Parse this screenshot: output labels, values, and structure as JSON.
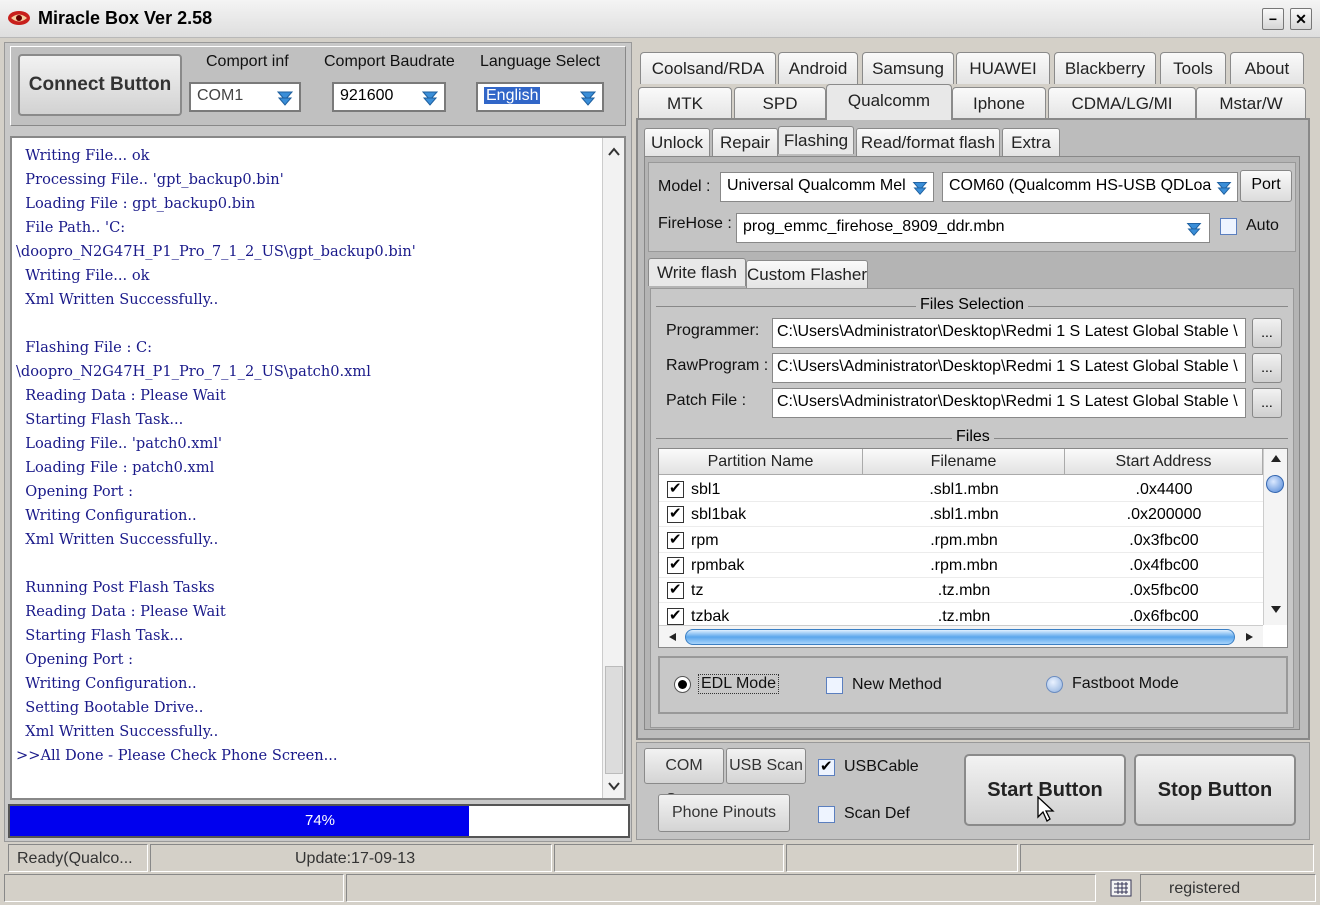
{
  "window": {
    "title": "Miracle Box Ver 2.58",
    "minimize": "−",
    "close": "✕"
  },
  "top": {
    "connect_label": "Connect Button",
    "comport_label": "Comport inf",
    "comport_value": "COM1",
    "baud_label": "Comport Baudrate",
    "baud_value": "921600",
    "lang_label": "Language Select",
    "lang_value": "English"
  },
  "log": {
    "lines": [
      "  Writing File... ok",
      "  Processing File.. 'gpt_backup0.bin'",
      "  Loading File : gpt_backup0.bin",
      "  File Path.. 'C:",
      "\\doopro_N2G47H_P1_Pro_7_1_2_US\\gpt_backup0.bin'",
      "  Writing File... ok",
      "  Xml Written Successfully..",
      "",
      "  Flashing File : C:",
      "\\doopro_N2G47H_P1_Pro_7_1_2_US\\patch0.xml",
      "  Reading Data : Please Wait",
      "  Starting Flash Task...",
      "  Loading File.. 'patch0.xml'",
      "  Loading File : patch0.xml",
      "  Opening Port :",
      "  Writing Configuration..",
      "  Xml Written Successfully..",
      "",
      "  Running Post Flash Tasks",
      "  Reading Data : Please Wait",
      "  Starting Flash Task...",
      "  Opening Port :",
      "  Writing Configuration..",
      "  Setting Bootable Drive..",
      "  Xml Written Successfully..",
      ">>All Done - Please Check Phone Screen..."
    ]
  },
  "progress": {
    "percent": 74,
    "label": "74%"
  },
  "status": {
    "left": "Ready(Qualco...",
    "update": "Update:17-09-13",
    "registered": "registered"
  },
  "tabs_row1": [
    "Coolsand/RDA",
    "Android",
    "Samsung",
    "HUAWEI",
    "Blackberry",
    "Tools",
    "About"
  ],
  "tabs_row2": [
    "MTK",
    "SPD",
    "Qualcomm",
    "Iphone",
    "CDMA/LG/MI",
    "Mstar/W"
  ],
  "subtabs": [
    "Unlock",
    "Repair",
    "Flashing",
    "Read/format flash",
    "Extra"
  ],
  "model": {
    "model_label": "Model :",
    "model_value": "Universal Qualcomm Mel",
    "port_value": "COM60 (Qualcomm HS-USB QDLoa",
    "port_button": "Port",
    "firehose_label": "FireHose :",
    "firehose_value": "prog_emmc_firehose_8909_ddr.mbn",
    "auto_label": "Auto"
  },
  "flash_tabs": [
    "Write flash",
    "Custom Flasher"
  ],
  "files_selection": {
    "title": "Files Selection",
    "programmer_label": "Programmer:",
    "programmer_value": "C:\\Users\\Administrator\\Desktop\\Redmi 1 S Latest Global Stable \\",
    "rawprogram_label": "RawProgram :",
    "rawprogram_value": "C:\\Users\\Administrator\\Desktop\\Redmi 1 S Latest Global Stable \\",
    "patch_label": "Patch File :",
    "patch_value": "C:\\Users\\Administrator\\Desktop\\Redmi 1 S Latest Global Stable \\",
    "browse": "..."
  },
  "files": {
    "title": "Files",
    "columns": [
      "Partition Name",
      "Filename",
      "Start Address"
    ],
    "rows": [
      {
        "name": "sbl1",
        "file": ".sbl1.mbn",
        "addr": ".0x4400"
      },
      {
        "name": "sbl1bak",
        "file": ".sbl1.mbn",
        "addr": ".0x200000"
      },
      {
        "name": "rpm",
        "file": ".rpm.mbn",
        "addr": ".0x3fbc00"
      },
      {
        "name": "rpmbak",
        "file": ".rpm.mbn",
        "addr": ".0x4fbc00"
      },
      {
        "name": "tz",
        "file": ".tz.mbn",
        "addr": ".0x5fbc00"
      },
      {
        "name": "tzbak",
        "file": ".tz.mbn",
        "addr": ".0x6fbc00"
      }
    ]
  },
  "modes": {
    "edl": "EDL Mode",
    "new_method": "New Method",
    "fastboot": "Fastboot Mode"
  },
  "bottom": {
    "com_scan": "COM Scan",
    "usb_scan": "USB Scan",
    "usbcable": "USBCable",
    "phone_pinouts": "Phone Pinouts",
    "scan_def": "Scan Def",
    "start": "Start Button",
    "stop": "Stop Button"
  },
  "colors": {
    "progress": "#0000ee",
    "log_text": "#1a1a8a"
  }
}
